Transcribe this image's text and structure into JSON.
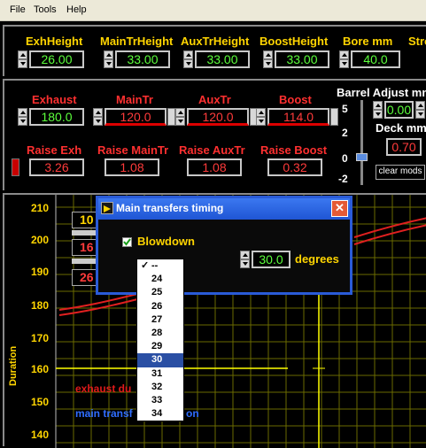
{
  "menu": [
    "File",
    "Tools",
    "Help"
  ],
  "row1": {
    "labels": [
      "ExhHeight",
      "MainTrHeight",
      "AuxTrHeight",
      "BoostHeight",
      "Bore mm",
      "Stro"
    ],
    "values": [
      "26.00",
      "33.00",
      "33.00",
      "33.00",
      "40.0"
    ]
  },
  "row2": {
    "labels": [
      "Exhaust",
      "MainTr",
      "AuxTr",
      "Boost"
    ],
    "values": [
      "180.0",
      "120.0",
      "120.0",
      "114.0"
    ]
  },
  "row3": {
    "labels": [
      "Raise Exh",
      "Raise MainTr",
      "Raise AuxTr",
      "Raise Boost"
    ],
    "values": [
      "3.26",
      "1.08",
      "1.08",
      "0.32"
    ]
  },
  "barrel": {
    "label": "Barrel Adjust mm",
    "value": "0.00",
    "scale": [
      "5",
      "2",
      "0",
      "-2"
    ],
    "deck_label": "Deck mm",
    "deck_value": "0.70",
    "clear_label": "clear mods"
  },
  "chart": {
    "ylabel": "Duration",
    "yticks": [
      "210",
      "200",
      "190",
      "180",
      "170",
      "160",
      "150",
      "140"
    ],
    "legend_exhaust": "exhaust du",
    "legend_main": "main transf",
    "legend_main_tail": "on",
    "box_labels": [
      "10",
      "16",
      "26"
    ]
  },
  "dialog": {
    "title": "Main transfers timing",
    "blowdown_label": "Blowdown",
    "blowdown_checked": true,
    "degrees_value": "30.0",
    "degrees_label": "degrees",
    "dropdown_items": [
      "--",
      "24",
      "25",
      "26",
      "27",
      "28",
      "29",
      "30",
      "31",
      "32",
      "33",
      "34"
    ],
    "dropdown_selected": "30",
    "dropdown_checked": "--"
  },
  "colors": {
    "value_green": "#5cff3c",
    "value_red": "#ff3b3b",
    "label_yellow": "#ffd500",
    "label_red": "#ff3030",
    "title_blue": "#2a5bd7"
  }
}
